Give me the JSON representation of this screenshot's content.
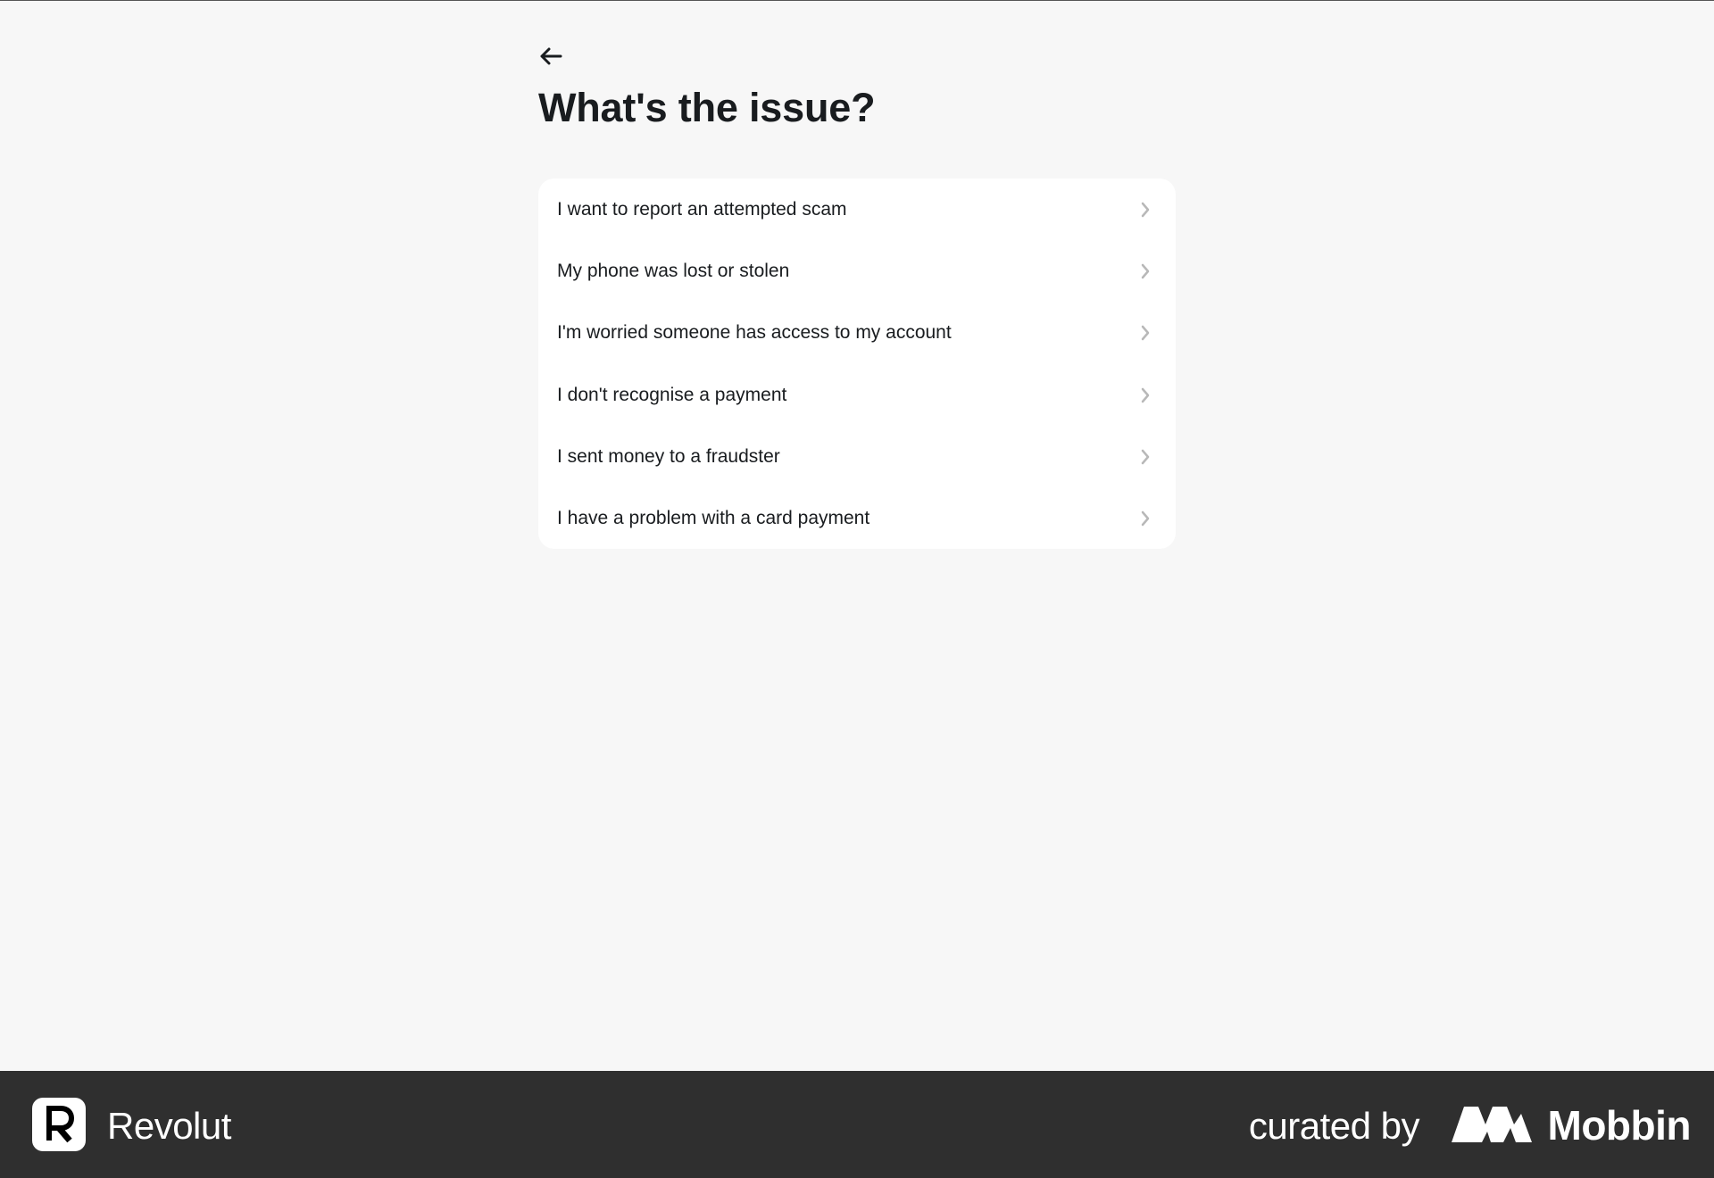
{
  "header": {
    "back_icon": "arrow-left-icon",
    "title": "What's the issue?"
  },
  "options": [
    {
      "label": "I want to report an attempted scam",
      "icon": "chevron-right-icon"
    },
    {
      "label": "My phone was lost or stolen",
      "icon": "chevron-right-icon"
    },
    {
      "label": "I'm worried someone has access to my account",
      "icon": "chevron-right-icon"
    },
    {
      "label": "I don't recognise a payment",
      "icon": "chevron-right-icon"
    },
    {
      "label": "I sent money to a fraudster",
      "icon": "chevron-right-icon"
    },
    {
      "label": "I have a problem with a card payment",
      "icon": "chevron-right-icon"
    }
  ],
  "footer": {
    "brand_name": "Revolut",
    "brand_icon": "revolut-logo-icon",
    "curated_by": "curated by",
    "curator_name": "Mobbin",
    "curator_icon": "mobbin-logo-icon"
  },
  "colors": {
    "background": "#f7f7f7",
    "card": "#ffffff",
    "text": "#191c1f",
    "chevron": "#b8b8b8",
    "footer": "#2f2f2f"
  }
}
